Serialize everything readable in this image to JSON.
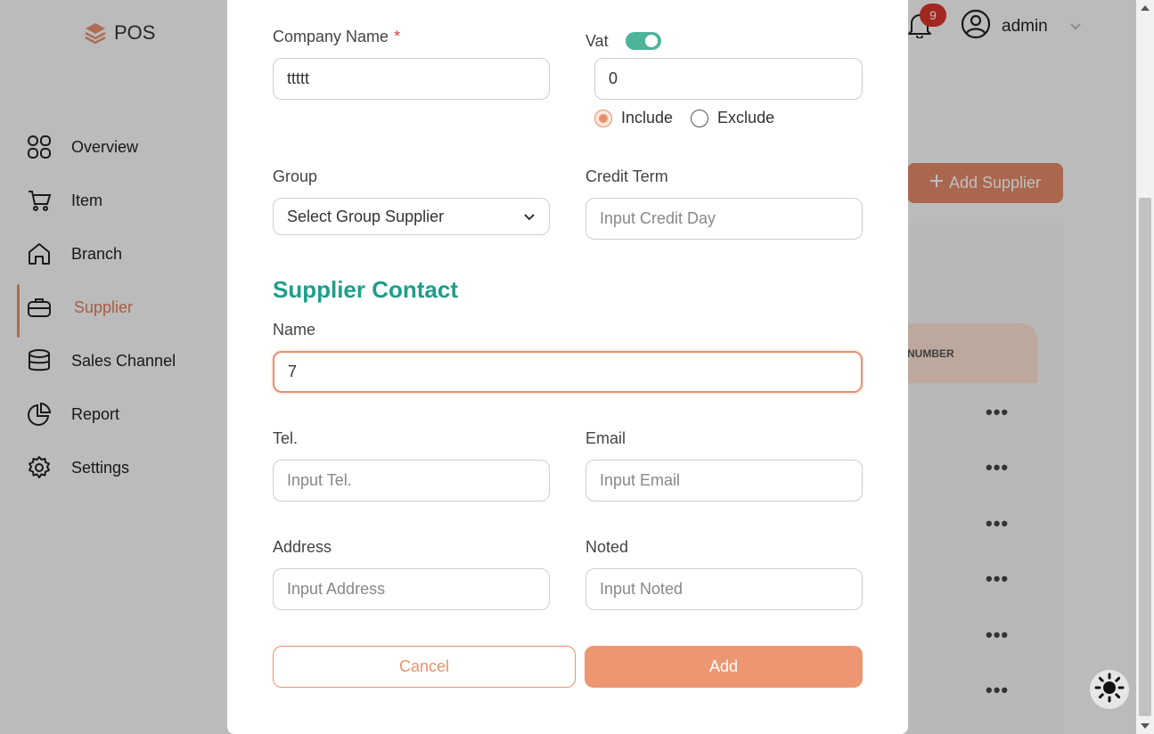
{
  "app": {
    "logo_text": "POS",
    "notification_count": "9",
    "user_name": "admin"
  },
  "sidebar": {
    "items": [
      {
        "label": "Overview",
        "icon": "grid-icon"
      },
      {
        "label": "Item",
        "icon": "cart-icon"
      },
      {
        "label": "Branch",
        "icon": "home-icon"
      },
      {
        "label": "Supplier",
        "icon": "briefcase-icon",
        "active": true
      },
      {
        "label": "Sales Channel",
        "icon": "database-icon"
      },
      {
        "label": "Report",
        "icon": "pie-chart-icon"
      },
      {
        "label": "Settings",
        "icon": "gear-icon"
      }
    ]
  },
  "page": {
    "add_supplier_label": "Add Supplier",
    "table_header_fragment": "NUMBER"
  },
  "modal": {
    "company_name_label": "Company Name",
    "required_mark": "*",
    "company_name_value": "ttttt",
    "vat_label": "Vat",
    "vat_value": "0",
    "vat_include_label": "Include",
    "vat_exclude_label": "Exclude",
    "group_label": "Group",
    "group_selected": "Select Group Supplier",
    "credit_term_label": "Credit Term",
    "credit_term_placeholder": "Input Credit Day",
    "section_title": "Supplier Contact",
    "name_label": "Name",
    "name_value": "7",
    "tel_label": "Tel.",
    "tel_placeholder": "Input Tel.",
    "email_label": "Email",
    "email_placeholder": "Input Email",
    "address_label": "Address",
    "address_placeholder": "Input Address",
    "noted_label": "Noted",
    "noted_placeholder": "Input Noted",
    "cancel_label": "Cancel",
    "add_label": "Add"
  },
  "colors": {
    "accent": "#e8916f",
    "section_title": "#1e9e8a",
    "toggle_on": "#4db39a",
    "badge": "#d9342b"
  }
}
